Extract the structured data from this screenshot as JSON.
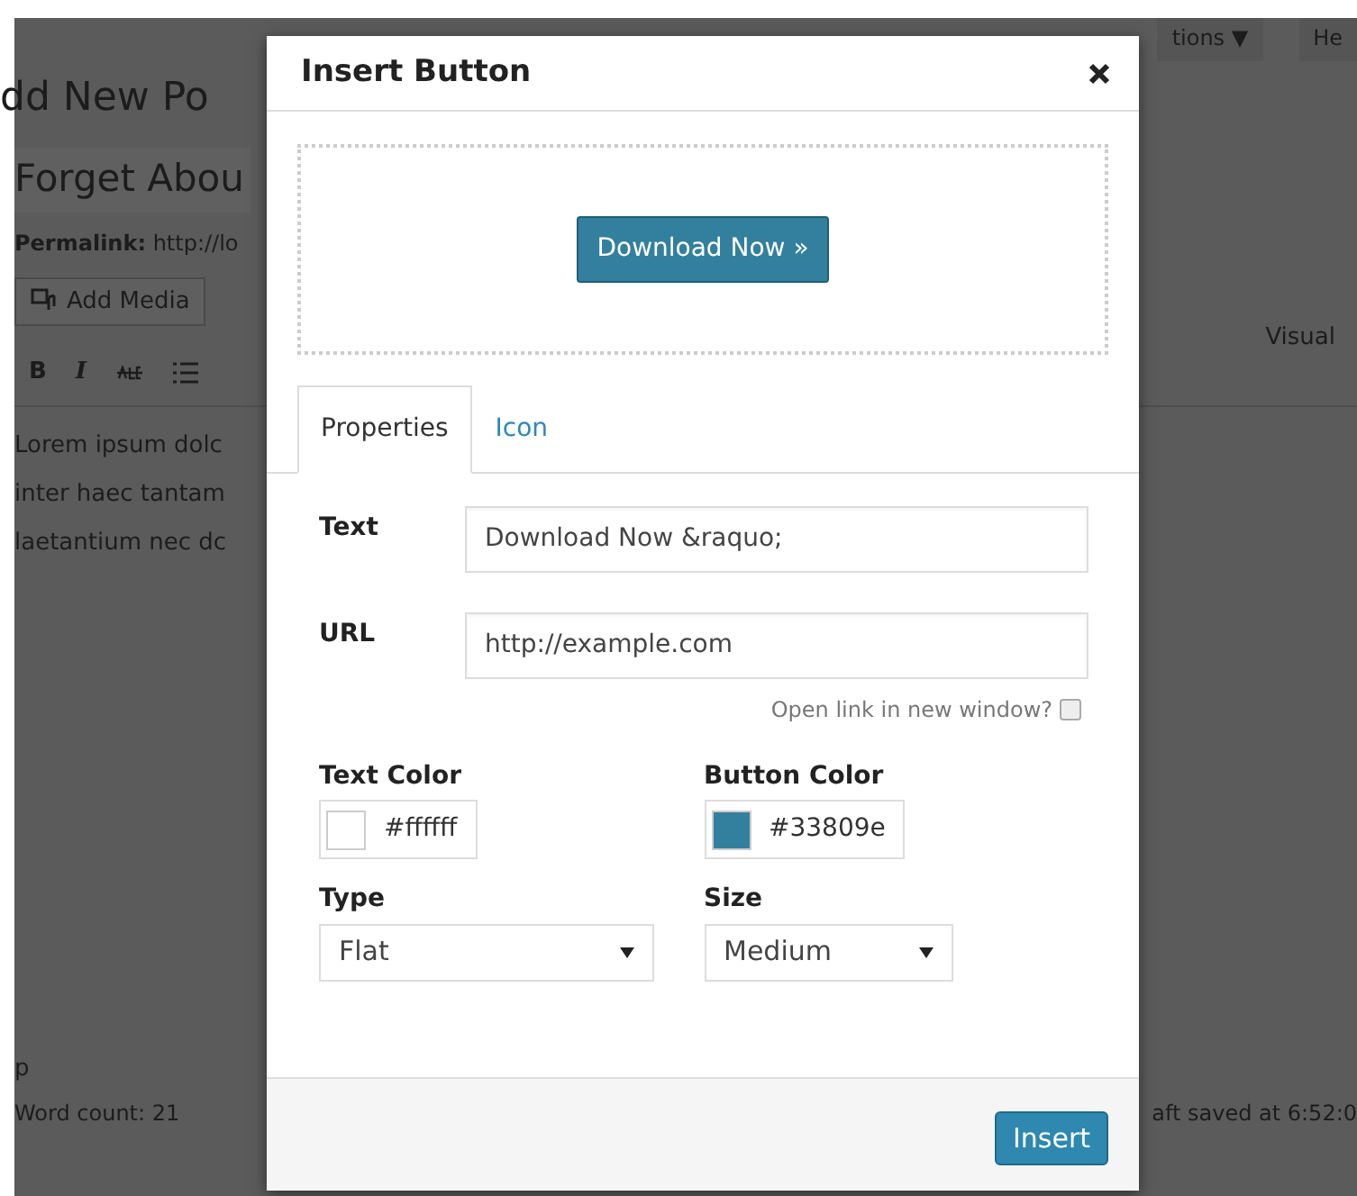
{
  "background": {
    "screen_options": "tions ▼",
    "help": "He",
    "page_title": "dd New Po",
    "post_title": "Forget Abou",
    "permalink": "**Permalink:** http://lo",
    "add_media": "Add Media",
    "toolbar": [
      "B",
      "I"
    ],
    "editor_tab": "Visual",
    "body_lines": [
      "Lorem ipsum dolc",
      "inter haec tantam",
      "laetantium nec dc"
    ],
    "path": "p",
    "word_count": "Word count: 21",
    "draft_saved": "aft saved at 6:52:0"
  },
  "modal": {
    "title": "Insert Button",
    "preview_button": "Download Now »",
    "tabs": [
      {
        "label": "Properties",
        "selected": true
      },
      {
        "label": "Icon",
        "selected": false
      }
    ],
    "text": {
      "label": "Text",
      "value": "Download Now &raquo;"
    },
    "url": {
      "label": "URL",
      "value": "http://example.com"
    },
    "new_window": {
      "label": "Open link in new window?",
      "checked": false
    },
    "text_color": {
      "label": "Text Color",
      "value": "#ffffff"
    },
    "button_color": {
      "label": "Button Color",
      "value": "#33809e"
    },
    "type": {
      "label": "Type",
      "value": "Flat"
    },
    "size": {
      "label": "Size",
      "value": "Medium"
    },
    "insert": "Insert"
  }
}
